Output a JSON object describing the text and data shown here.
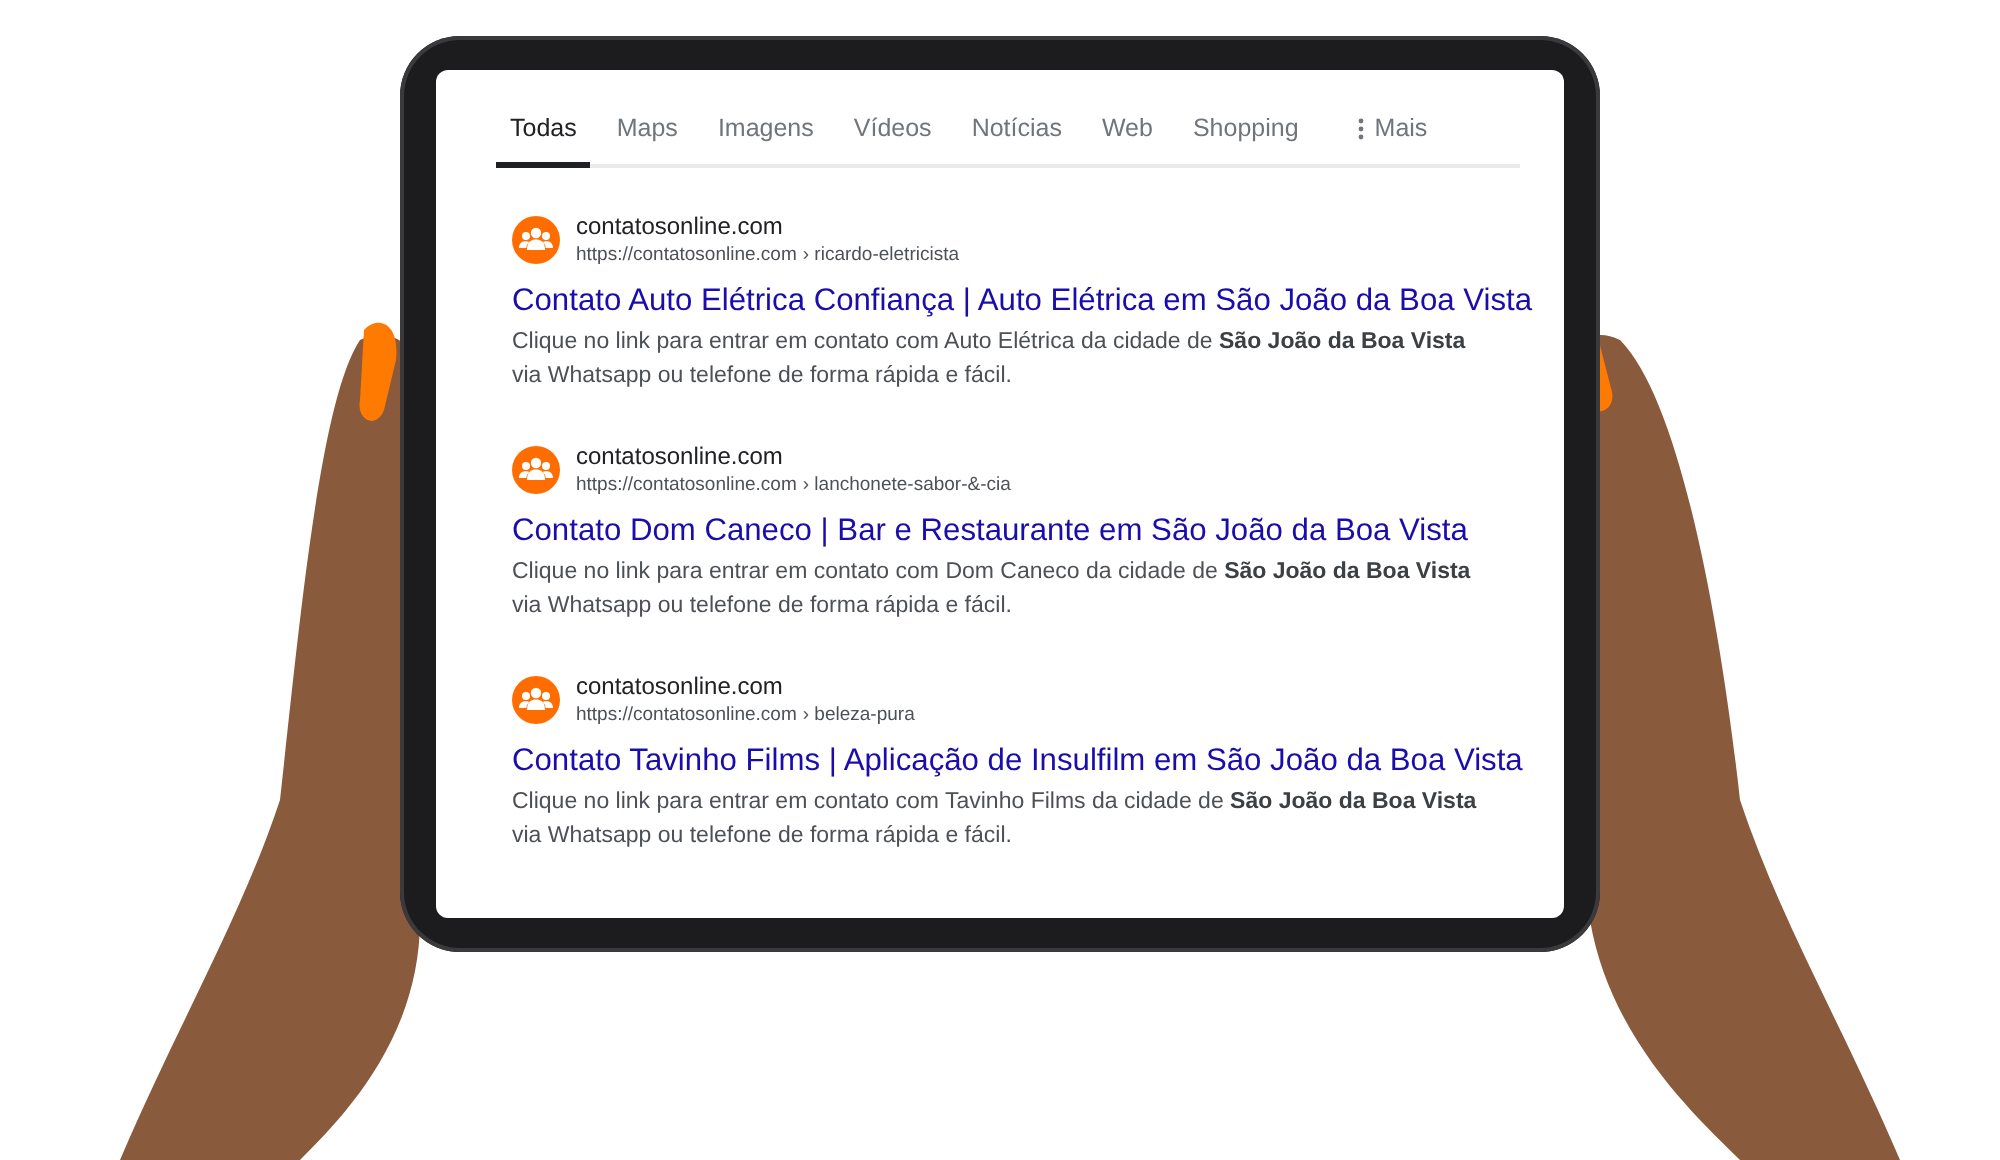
{
  "tabs": [
    {
      "label": "Todas",
      "selected": true,
      "kind": "tab"
    },
    {
      "label": "Maps",
      "selected": false,
      "kind": "tab"
    },
    {
      "label": "Imagens",
      "selected": false,
      "kind": "tab"
    },
    {
      "label": "Vídeos",
      "selected": false,
      "kind": "tab"
    },
    {
      "label": "Notícias",
      "selected": false,
      "kind": "tab"
    },
    {
      "label": "Web",
      "selected": false,
      "kind": "tab"
    },
    {
      "label": "Shopping",
      "selected": false,
      "kind": "tab"
    },
    {
      "label": "Mais",
      "selected": false,
      "kind": "more"
    }
  ],
  "results": [
    {
      "site": "contatosonline.com",
      "url": "https://contatosonline.com",
      "path": "› ricardo-eletricista",
      "title": "Contato Auto Elétrica Confiança | Auto Elétrica em São João da Boa Vista",
      "snippet": "Clique no link para entrar em contato com Auto Elétrica da cidade de **São João da Boa Vista**\nvia Whatsapp ou telefone de forma rápida e fácil."
    },
    {
      "site": "contatosonline.com",
      "url": "https://contatosonline.com",
      "path": "› lanchonete-sabor-&-cia",
      "title": "Contato Dom Caneco | Bar e Restaurante em São João da Boa Vista",
      "snippet": "Clique no link para entrar em contato com Dom Caneco da cidade de **São João da Boa Vista**\nvia Whatsapp ou telefone de forma rápida e fácil."
    },
    {
      "site": "contatosonline.com",
      "url": "https://contatosonline.com",
      "path": "› beleza-pura",
      "title": "Contato Tavinho Films | Aplicação de Insulfilm em São João da Boa Vista",
      "snippet": "Clique no link para entrar em contato com Tavinho Films da cidade de **São João da Boa Vista**\nvia Whatsapp ou telefone de forma rápida e fácil."
    }
  ]
}
